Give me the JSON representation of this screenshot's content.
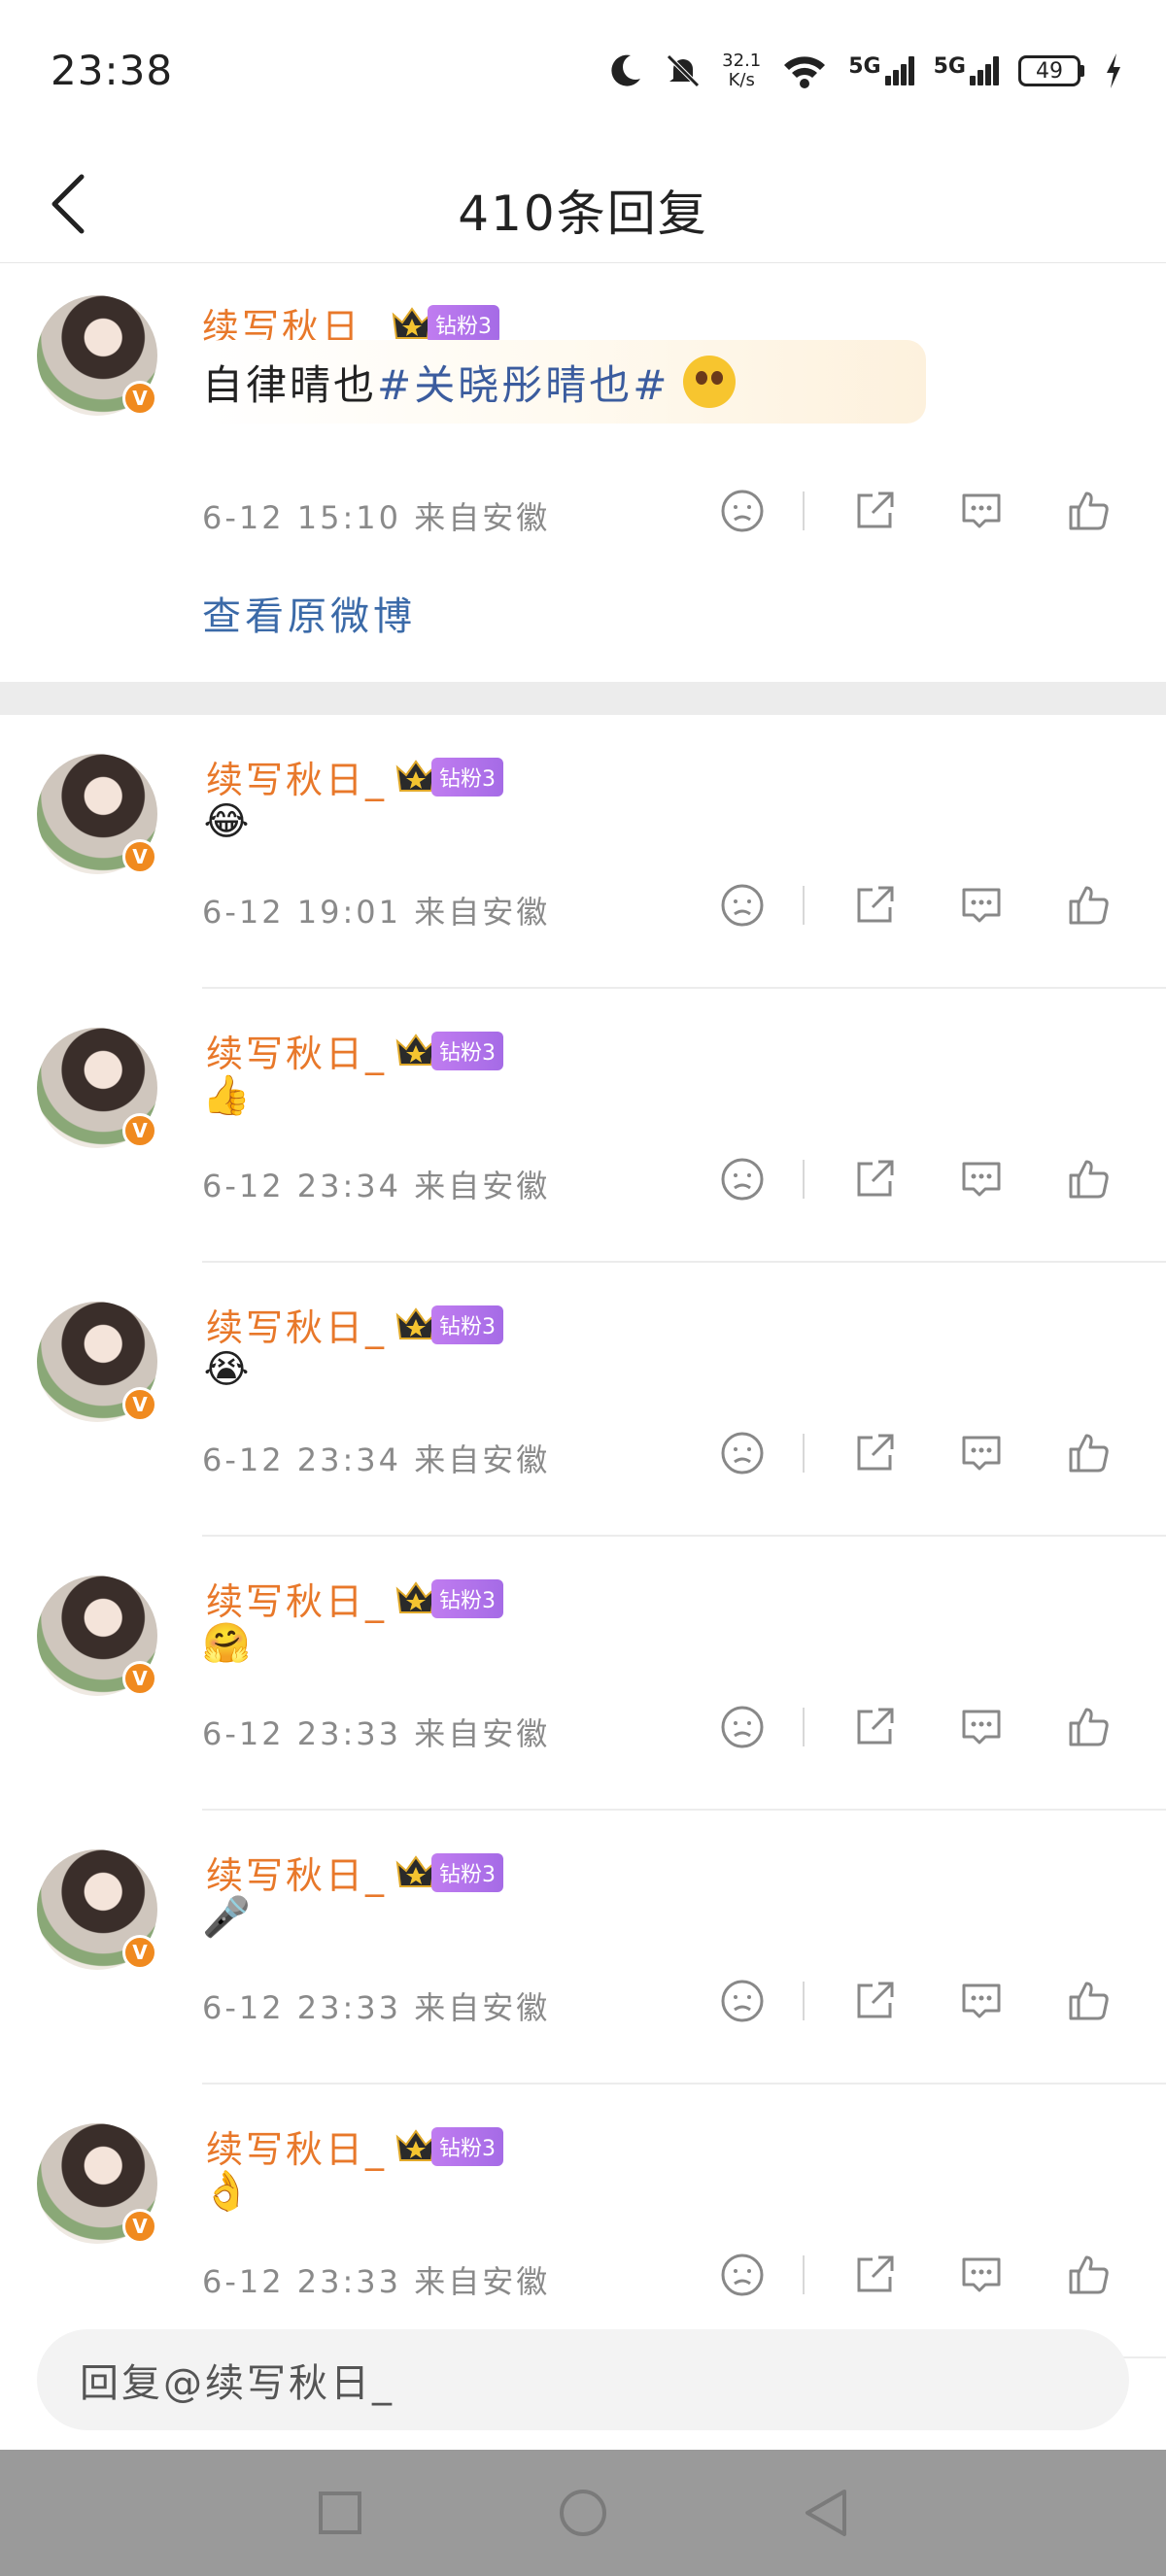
{
  "status_bar": {
    "time": "23:38",
    "speed_value": "32.1",
    "speed_unit": "K/s",
    "network_1": "5G",
    "network_2": "5G",
    "battery": "49"
  },
  "header": {
    "title": "410条回复"
  },
  "top_comment": {
    "username": "续写秋日_",
    "fan_tag": "钻粉3",
    "text_prefix": "自律晴也",
    "hashtag": "#关晓彤晴也#",
    "meta": "6-12 15:10 来自安徽",
    "view_original": "查看原微博"
  },
  "replies": [
    {
      "username": "续写秋日_",
      "fan_tag": "钻粉3",
      "emoji": "😂",
      "meta": "6-12 19:01 来自安徽"
    },
    {
      "username": "续写秋日_",
      "fan_tag": "钻粉3",
      "emoji": "👍",
      "meta": "6-12 23:34 来自安徽"
    },
    {
      "username": "续写秋日_",
      "fan_tag": "钻粉3",
      "emoji": "😭",
      "meta": "6-12 23:34 来自安徽"
    },
    {
      "username": "续写秋日_",
      "fan_tag": "钻粉3",
      "emoji": "🤗",
      "meta": "6-12 23:33 来自安徽"
    },
    {
      "username": "续写秋日_",
      "fan_tag": "钻粉3",
      "emoji": "🎤",
      "meta": "6-12 23:33 来自安徽"
    },
    {
      "username": "续写秋日_",
      "fan_tag": "钻粉3",
      "emoji": "👌",
      "meta": "6-12 23:33 来自安徽"
    }
  ],
  "input": {
    "placeholder": "回复@续写秋日_"
  },
  "icons": {
    "dislike": "frown-icon",
    "share": "share-icon",
    "comment": "comment-icon",
    "like": "thumbs-up-icon"
  },
  "colors": {
    "username": "#e8782a",
    "link": "#3b6aa8",
    "hashtag": "#3b5c9e",
    "fan_tag": "#b274ec"
  }
}
